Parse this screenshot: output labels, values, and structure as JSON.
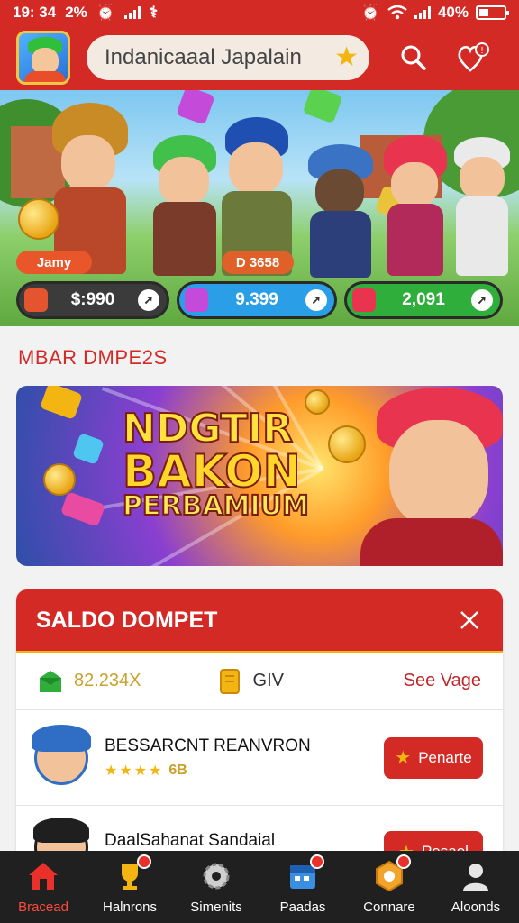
{
  "status_bar": {
    "time": "19: 34",
    "battery_text": "2%",
    "right_battery": "40%",
    "battery_level": 0.4
  },
  "header": {
    "search_text": "Indanicaaal Japalain",
    "icons": [
      "app-avatar",
      "star-icon",
      "search-icon",
      "heart-notification-icon"
    ]
  },
  "hero": {
    "chips": [
      "Jamy",
      "D 3658"
    ],
    "stats": [
      {
        "value": "$:990",
        "color": "#3b3b3b"
      },
      {
        "value": "9.399",
        "color": "#2a9ee6"
      },
      {
        "value": "2,091",
        "color": "#2fae3c"
      }
    ]
  },
  "section": {
    "title": "MBAR DMPE2S"
  },
  "promo": {
    "line1": "NDGTIR",
    "line2": "BAKON",
    "line3": "PERBAMIUM"
  },
  "wallet": {
    "title": "SALDO DOMPET",
    "stat_value": "82.234X",
    "stat_label": "GIV",
    "see_page": "See Vage",
    "rows": [
      {
        "name": "BESSARCNT REANVRON",
        "rating": "6B",
        "stars": 4,
        "button": "Penarte"
      },
      {
        "name": "DaalSahanat Sandaial",
        "rating": "",
        "stars": 0,
        "button": "Pesael"
      }
    ]
  },
  "nav": [
    {
      "label": "Bracead",
      "icon": "home-icon",
      "active": true
    },
    {
      "label": "Halnrons",
      "icon": "trophy-icon",
      "active": false
    },
    {
      "label": "Simenits",
      "icon": "gear-icon",
      "active": false
    },
    {
      "label": "Paadas",
      "icon": "calendar-icon",
      "active": false
    },
    {
      "label": "Connare",
      "icon": "badge-icon",
      "active": false
    },
    {
      "label": "Aloonds",
      "icon": "profile-icon",
      "active": false
    }
  ],
  "colors": {
    "brand_red": "#d42a26",
    "gold": "#f2b511",
    "nav_bg": "#202020"
  }
}
